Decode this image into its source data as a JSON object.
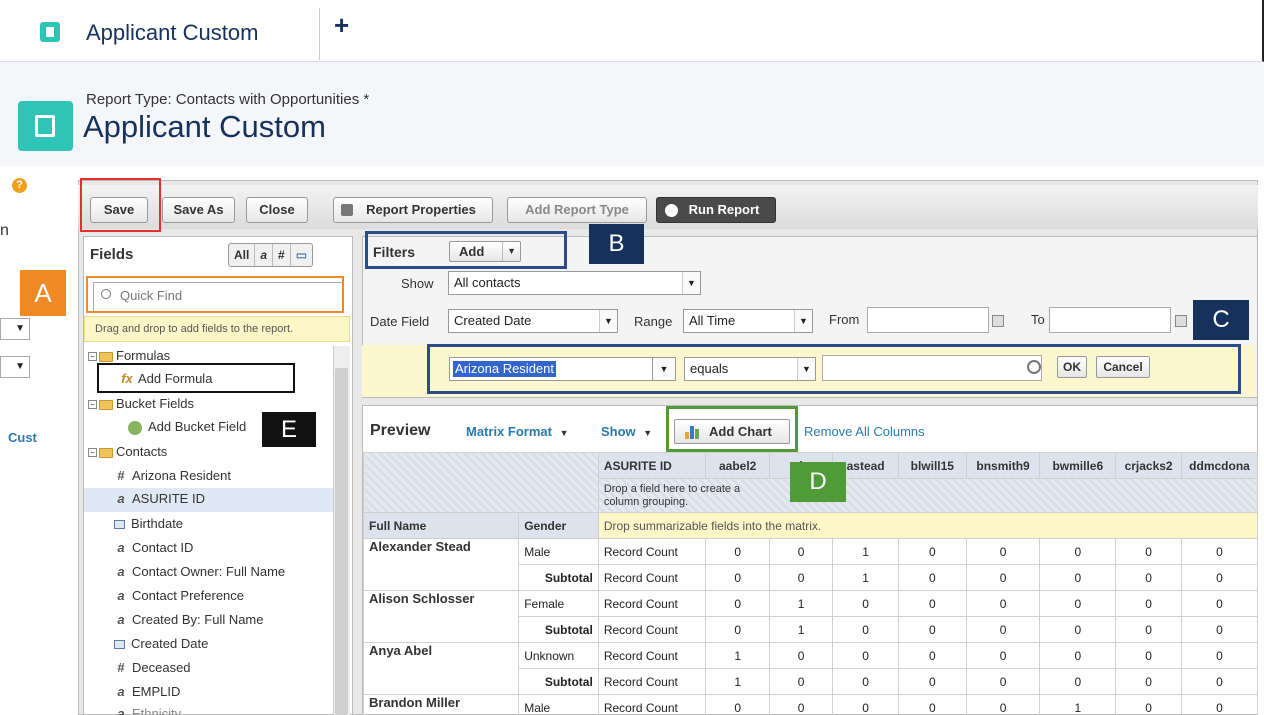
{
  "tab": {
    "title": "Applicant Custom",
    "add_label": "+"
  },
  "header": {
    "report_type": "Report Type: Contacts with Opportunities *",
    "title": "Applicant Custom"
  },
  "left_strip": {
    "help": "?",
    "n_letter": "n",
    "cust_link": "Cust"
  },
  "toolbar": {
    "save": "Save",
    "save_as": "Save As",
    "close": "Close",
    "report_properties": "Report Properties",
    "add_report_type": "Add Report Type",
    "run_report": "Run Report"
  },
  "fields_panel": {
    "title": "Fields",
    "type_filters": [
      "All",
      "a",
      "#",
      "▭"
    ],
    "quick_find_placeholder": "Quick Find",
    "hint": "Drag and drop to add fields to the report.",
    "tree": {
      "formulas": "Formulas",
      "add_formula": "Add Formula",
      "bucket_fields": "Bucket Fields",
      "add_bucket_field": "Add Bucket Field",
      "contacts": "Contacts",
      "items": [
        {
          "icon": "#",
          "label": "Arizona Resident"
        },
        {
          "icon": "a",
          "label": "ASURITE ID"
        },
        {
          "icon": "cal",
          "label": "Birthdate"
        },
        {
          "icon": "a",
          "label": "Contact ID"
        },
        {
          "icon": "a",
          "label": "Contact Owner: Full Name"
        },
        {
          "icon": "a",
          "label": "Contact Preference"
        },
        {
          "icon": "a",
          "label": "Created By: Full Name"
        },
        {
          "icon": "cal",
          "label": "Created Date"
        },
        {
          "icon": "#",
          "label": "Deceased"
        },
        {
          "icon": "a",
          "label": "EMPLID"
        },
        {
          "icon": "a",
          "label": "Ethnicity"
        }
      ]
    }
  },
  "filters": {
    "label": "Filters",
    "add": "Add",
    "show_label": "Show",
    "show_value": "All contacts",
    "date_field_label": "Date Field",
    "date_field_value": "Created Date",
    "range_label": "Range",
    "range_value": "All Time",
    "from_label": "From",
    "to_label": "To",
    "criteria": {
      "field": "Arizona Resident",
      "operator": "equals",
      "value": "",
      "ok": "OK",
      "cancel": "Cancel"
    }
  },
  "annotations": {
    "a": "A",
    "b": "B",
    "c": "C",
    "d": "D",
    "e": "E"
  },
  "preview": {
    "title": "Preview",
    "format": "Matrix Format",
    "show": "Show",
    "add_chart": "Add Chart",
    "remove_columns": "Remove All Columns",
    "matrix": {
      "col_group_label": "ASURITE ID",
      "columns": [
        "aabel2",
        "ajs",
        "astead",
        "blwill15",
        "bnsmith9",
        "bwmille6",
        "crjacks2",
        "ddmcdona"
      ],
      "drop_column": "Drop a field here to create a column grouping.",
      "row_headers": [
        "Full Name",
        "Gender"
      ],
      "drop_summary": "Drop summarizable fields into the matrix.",
      "metric": "Record Count",
      "subtotal": "Subtotal",
      "rows": [
        {
          "name": "Alexander Stead",
          "gender": "Male",
          "values": [
            "0",
            "0",
            "1",
            "0",
            "0",
            "0",
            "0",
            "0"
          ],
          "subtotal": [
            "0",
            "0",
            "1",
            "0",
            "0",
            "0",
            "0",
            "0"
          ]
        },
        {
          "name": "Alison Schlosser",
          "gender": "Female",
          "values": [
            "0",
            "1",
            "0",
            "0",
            "0",
            "0",
            "0",
            "0"
          ],
          "subtotal": [
            "0",
            "1",
            "0",
            "0",
            "0",
            "0",
            "0",
            "0"
          ]
        },
        {
          "name": "Anya Abel",
          "gender": "Unknown",
          "values": [
            "1",
            "0",
            "0",
            "0",
            "0",
            "0",
            "0",
            "0"
          ],
          "subtotal": [
            "1",
            "0",
            "0",
            "0",
            "0",
            "0",
            "0",
            "0"
          ]
        },
        {
          "name": "Brandon Miller",
          "gender": "Male",
          "values": [
            "0",
            "0",
            "0",
            "0",
            "0",
            "1",
            "0",
            "0"
          ],
          "subtotal": []
        }
      ]
    }
  }
}
